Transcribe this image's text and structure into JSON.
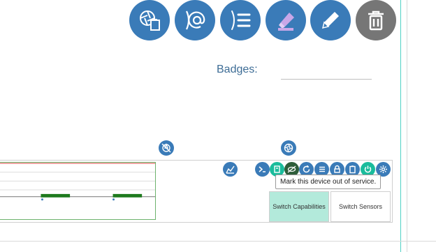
{
  "toolbar": {
    "icons": [
      {
        "name": "aperture-clipboard-icon",
        "color": "#3a7bb8"
      },
      {
        "name": "at-sign-icon",
        "color": "#3a7bb8"
      },
      {
        "name": "list-icon",
        "color": "#3a7bb8"
      },
      {
        "name": "highlighter-icon",
        "color": "#3a7bb8"
      },
      {
        "name": "pencil-icon",
        "color": "#3a7bb8"
      },
      {
        "name": "trash-icon",
        "color": "#767676"
      }
    ]
  },
  "badges": {
    "label": "Badges:"
  },
  "device_panel": {
    "tooltip": "Mark this device out of service.",
    "switch_capabilities": "Switch Capabilities",
    "switch_sensors": "Switch Sensors",
    "action_icons": [
      "terminal-icon",
      "out-of-service-icon",
      "eye-slash-icon",
      "refresh-icon",
      "list-icon",
      "lock-icon",
      "clipboard-icon",
      "power-icon",
      "gear-icon"
    ]
  },
  "colors": {
    "accent_blue": "#3a7bb8",
    "teal": "#4fd1c5",
    "switch_active_bg": "#b3eadb",
    "chart_border": "#6db36d",
    "chart_bar": "#1e7a1e"
  }
}
